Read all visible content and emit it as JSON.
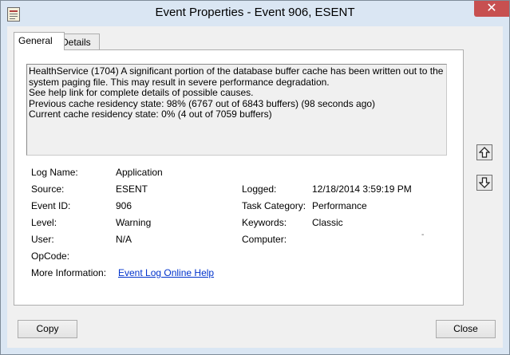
{
  "window": {
    "title": "Event Properties - Event 906, ESENT"
  },
  "tabs": [
    {
      "label": "General",
      "active": true
    },
    {
      "label": "Details",
      "active": false
    }
  ],
  "description": [
    "HealthService (1704) A significant portion of the database buffer cache has been written out to the",
    "system paging file. This may result in severe performance degradation.",
    "See help link for complete details of possible causes.",
    "Previous cache residency state: 98% (6767 out of 6843 buffers) (98 seconds ago)",
    "Current cache residency state: 0% (4 out of 7059 buffers)"
  ],
  "fields": {
    "log_name": {
      "label": "Log Name:",
      "value": "Application"
    },
    "source": {
      "label": "Source:",
      "value": "ESENT"
    },
    "logged": {
      "label": "Logged:",
      "value": "12/18/2014 3:59:19 PM"
    },
    "event_id": {
      "label": "Event ID:",
      "value": "906"
    },
    "task_category": {
      "label": "Task Category:",
      "value": "Performance"
    },
    "level": {
      "label": "Level:",
      "value": "Warning"
    },
    "keywords": {
      "label": "Keywords:",
      "value": "Classic"
    },
    "user": {
      "label": "User:",
      "value": "N/A"
    },
    "computer": {
      "label": "Computer:",
      "value": ""
    },
    "opcode": {
      "label": "OpCode:",
      "value": ""
    },
    "more_info": {
      "label": "More Information:",
      "link": "Event Log Online Help"
    }
  },
  "computer_mark": "-",
  "buttons": {
    "copy": "Copy",
    "close": "Close"
  },
  "icons": {
    "app": "event-viewer-icon",
    "up": "arrow-up-icon",
    "down": "arrow-down-icon",
    "close": "close-icon"
  },
  "colors": {
    "frame": "#dae6f3",
    "close_button": "#c75050",
    "link": "#0033cc"
  }
}
